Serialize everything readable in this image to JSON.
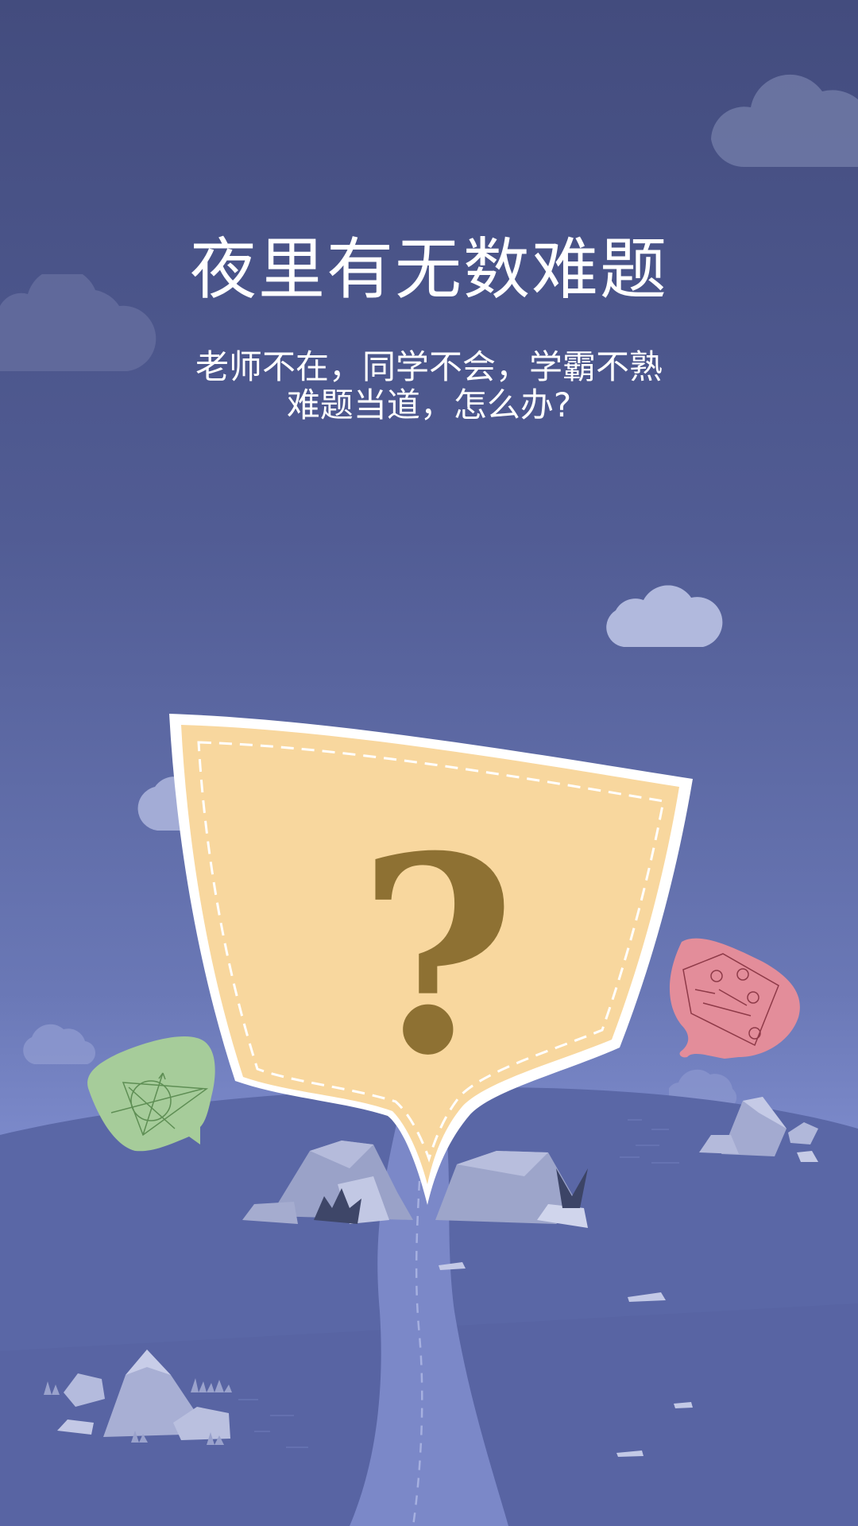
{
  "onboarding": {
    "title": "夜里有无数难题",
    "subtitle_line1": "老师不在，同学不会，学霸不熟",
    "subtitle_line2": "难题当道，怎么办?"
  },
  "icons": {
    "main_bubble": "question-mark-speech-bubble-icon",
    "left_bubble": "geometry-speech-bubble-icon",
    "right_bubble": "circuit-diagram-speech-bubble-icon"
  },
  "colors": {
    "sky_top": "#434c7e",
    "sky_bottom": "#7c8acb",
    "hill": "#5a67a6",
    "bubble_fill": "#f8d79e",
    "question_mark": "#8e7133",
    "left_bubble_fill": "#a6cc9a",
    "right_bubble_fill": "#e38d9a"
  }
}
